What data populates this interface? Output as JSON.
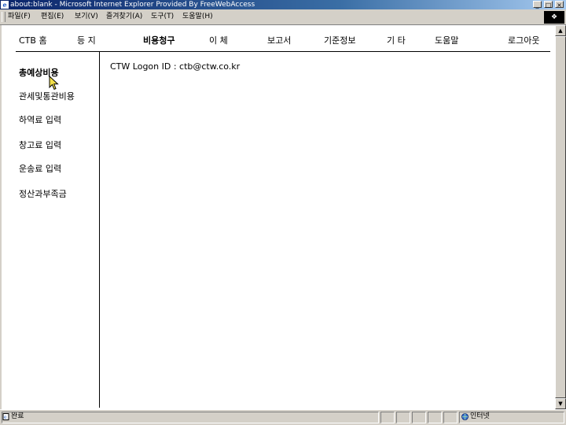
{
  "window": {
    "title": "about:blank - Microsoft Internet Explorer Provided By FreeWebAccess",
    "minimize": "_",
    "maximize": "×",
    "close": "×"
  },
  "menu": {
    "items": [
      "파일(F)",
      "편집(E)",
      "보기(V)",
      "즐겨찾기(A)",
      "도구(T)",
      "도움말(H)"
    ]
  },
  "nav": {
    "items": [
      {
        "label": "CTB 홈",
        "active": false
      },
      {
        "label": "등   지",
        "active": false
      },
      {
        "label": "비용청구",
        "active": true
      },
      {
        "label": "이   체",
        "active": false
      },
      {
        "label": "보고서",
        "active": false
      },
      {
        "label": "기준정보",
        "active": false
      },
      {
        "label": "기   타",
        "active": false
      },
      {
        "label": "도움말",
        "active": false
      },
      {
        "label": "로그아웃",
        "active": false
      }
    ]
  },
  "sidebar": {
    "items": [
      {
        "label": "총예상비용",
        "active": true
      },
      {
        "label": "관세및통관비용",
        "active": false
      },
      {
        "label": "하역료 입력",
        "active": false
      },
      {
        "label": "창고료 입력",
        "active": false
      },
      {
        "label": "운송료 입력",
        "active": false
      },
      {
        "label": "정산과부족금",
        "active": false
      }
    ]
  },
  "main": {
    "logon_text": "CTW Logon ID : ctb@ctw.co.kr"
  },
  "statusbar": {
    "status": "완료",
    "zone": "인터넷"
  },
  "colors": {
    "titlebar_start": "#0a246a",
    "titlebar_end": "#a6caf0",
    "chrome": "#d4d0c8"
  }
}
